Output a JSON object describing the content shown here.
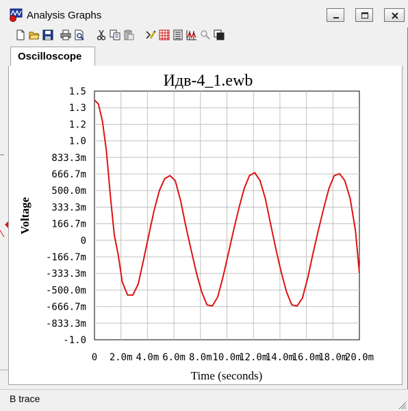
{
  "window": {
    "title": "Analysis Graphs",
    "controls": {
      "minimize": "minimize",
      "maximize": "maximize",
      "close": "close"
    }
  },
  "toolbar": {
    "items": [
      {
        "name": "new-icon"
      },
      {
        "name": "open-folder-icon"
      },
      {
        "name": "save-icon"
      },
      {
        "name": "print-icon"
      },
      {
        "name": "print-preview-icon"
      },
      {
        "name": "cut-icon"
      },
      {
        "name": "copy-icon"
      },
      {
        "name": "paste-icon"
      },
      {
        "name": "properties-icon"
      },
      {
        "name": "grid-toggle-icon"
      },
      {
        "name": "legend-toggle-icon"
      },
      {
        "name": "cursors-toggle-icon"
      },
      {
        "name": "zoom-icon"
      },
      {
        "name": "reverse-colors-icon"
      }
    ]
  },
  "tabs": [
    {
      "label": "Oscilloscope",
      "active": true
    }
  ],
  "status": {
    "text": "B trace"
  },
  "chart_data": {
    "type": "line",
    "title": "Идв-4_1.ewb",
    "xlabel": "Time (seconds)",
    "ylabel": "Voltage",
    "xlim": [
      0,
      0.02
    ],
    "ylim": [
      -1.0,
      1.5
    ],
    "grid": true,
    "x_ticks": [
      "0",
      "2.0m",
      "4.0m",
      "6.0m",
      "8.0m",
      "10.0m",
      "12.0m",
      "14.0m",
      "16.0m",
      "18.0m",
      "20.0m"
    ],
    "x_tick_values": [
      0,
      0.002,
      0.004,
      0.006,
      0.008,
      0.01,
      0.012,
      0.014,
      0.016,
      0.018,
      0.02
    ],
    "y_ticks": [
      "1.5",
      "1.3",
      "1.2",
      "1.0",
      "833.3m",
      "666.7m",
      "500.0m",
      "333.3m",
      "166.7m",
      "0",
      "-166.7m",
      "-333.3m",
      "-500.0m",
      "-666.7m",
      "-833.3m",
      "-1.0"
    ],
    "y_tick_values": [
      1.5,
      1.3333,
      1.1667,
      1.0,
      0.8333,
      0.6667,
      0.5,
      0.3333,
      0.1667,
      0,
      -0.1667,
      -0.3333,
      -0.5,
      -0.6667,
      -0.8333,
      -1.0
    ],
    "series": [
      {
        "color": "#e01010",
        "x": [
          0,
          0.0003,
          0.0006,
          0.0009,
          0.0012,
          0.0015,
          0.0018,
          0.0021,
          0.0025,
          0.0029,
          0.0033,
          0.0037,
          0.0041,
          0.0045,
          0.0049,
          0.0053,
          0.0057,
          0.0061,
          0.0065,
          0.0069,
          0.0073,
          0.0077,
          0.0081,
          0.0085,
          0.0089,
          0.0093,
          0.0097,
          0.0101,
          0.0105,
          0.0109,
          0.0113,
          0.0117,
          0.0121,
          0.0125,
          0.0129,
          0.0133,
          0.0137,
          0.0141,
          0.0145,
          0.0149,
          0.0153,
          0.0157,
          0.0161,
          0.0165,
          0.0169,
          0.0173,
          0.0177,
          0.0181,
          0.0185,
          0.0189,
          0.0193,
          0.0197,
          0.02
        ],
        "y": [
          1.41,
          1.37,
          1.2,
          0.9,
          0.45,
          0.05,
          -0.15,
          -0.42,
          -0.55,
          -0.55,
          -0.44,
          -0.2,
          0.05,
          0.3,
          0.5,
          0.62,
          0.65,
          0.6,
          0.4,
          0.14,
          -0.1,
          -0.33,
          -0.52,
          -0.65,
          -0.66,
          -0.57,
          -0.37,
          -0.14,
          0.1,
          0.32,
          0.52,
          0.65,
          0.68,
          0.6,
          0.42,
          0.16,
          -0.09,
          -0.32,
          -0.52,
          -0.65,
          -0.66,
          -0.58,
          -0.38,
          -0.13,
          0.1,
          0.32,
          0.52,
          0.65,
          0.67,
          0.6,
          0.42,
          0.1,
          -0.33
        ]
      }
    ]
  }
}
